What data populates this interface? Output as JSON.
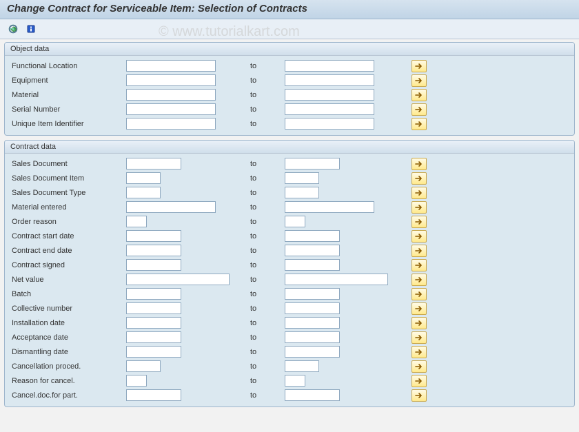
{
  "title": "Change Contract for Serviceable Item: Selection of Contracts",
  "watermark": "© www.tutorialkart.com",
  "to_label": "to",
  "groups": {
    "object_data": {
      "title": "Object data",
      "rows": [
        {
          "label": "Functional Location",
          "from": "",
          "to": "",
          "w1": "w-full",
          "w2": "w-full"
        },
        {
          "label": "Equipment",
          "from": "",
          "to": "",
          "w1": "w-full",
          "w2": "w-full"
        },
        {
          "label": "Material",
          "from": "",
          "to": "",
          "w1": "w-full",
          "w2": "w-full"
        },
        {
          "label": "Serial Number",
          "from": "",
          "to": "",
          "w1": "w-full",
          "w2": "w-full"
        },
        {
          "label": "Unique Item Identifier",
          "from": "",
          "to": "",
          "w1": "w-full",
          "w2": "w-full"
        }
      ]
    },
    "contract_data": {
      "title": "Contract data",
      "rows": [
        {
          "label": "Sales Document",
          "from": "",
          "to": "",
          "w1": "w-med",
          "w2": "w-med"
        },
        {
          "label": "Sales Document Item",
          "from": "",
          "to": "",
          "w1": "w-short",
          "w2": "w-short"
        },
        {
          "label": "Sales Document Type",
          "from": "",
          "to": "",
          "w1": "w-short",
          "w2": "w-short"
        },
        {
          "label": "Material entered",
          "from": "",
          "to": "",
          "w1": "w-full",
          "w2": "w-full"
        },
        {
          "label": "Order reason",
          "from": "",
          "to": "",
          "w1": "w-tiny",
          "w2": "w-tiny"
        },
        {
          "label": "Contract start date",
          "from": "",
          "to": "",
          "w1": "w-med",
          "w2": "w-med"
        },
        {
          "label": "Contract end date",
          "from": "",
          "to": "",
          "w1": "w-med",
          "w2": "w-med"
        },
        {
          "label": "Contract signed",
          "from": "",
          "to": "",
          "w1": "w-med",
          "w2": "w-med"
        },
        {
          "label": "Net value",
          "from": "",
          "to": "",
          "w1": "w-xl",
          "w2": "w-xl"
        },
        {
          "label": "Batch",
          "from": "",
          "to": "",
          "w1": "w-med",
          "w2": "w-med"
        },
        {
          "label": "Collective number",
          "from": "",
          "to": "",
          "w1": "w-med",
          "w2": "w-med"
        },
        {
          "label": "Installation date",
          "from": "",
          "to": "",
          "w1": "w-med",
          "w2": "w-med"
        },
        {
          "label": "Acceptance date",
          "from": "",
          "to": "",
          "w1": "w-med",
          "w2": "w-med"
        },
        {
          "label": "Dismantling date",
          "from": "",
          "to": "",
          "w1": "w-med",
          "w2": "w-med"
        },
        {
          "label": "Cancellation proced.",
          "from": "",
          "to": "",
          "w1": "w-short",
          "w2": "w-short"
        },
        {
          "label": "Reason for cancel.",
          "from": "",
          "to": "",
          "w1": "w-tiny",
          "w2": "w-tiny"
        },
        {
          "label": "Cancel.doc.for part.",
          "from": "",
          "to": "",
          "w1": "w-med",
          "w2": "w-med"
        }
      ]
    }
  }
}
